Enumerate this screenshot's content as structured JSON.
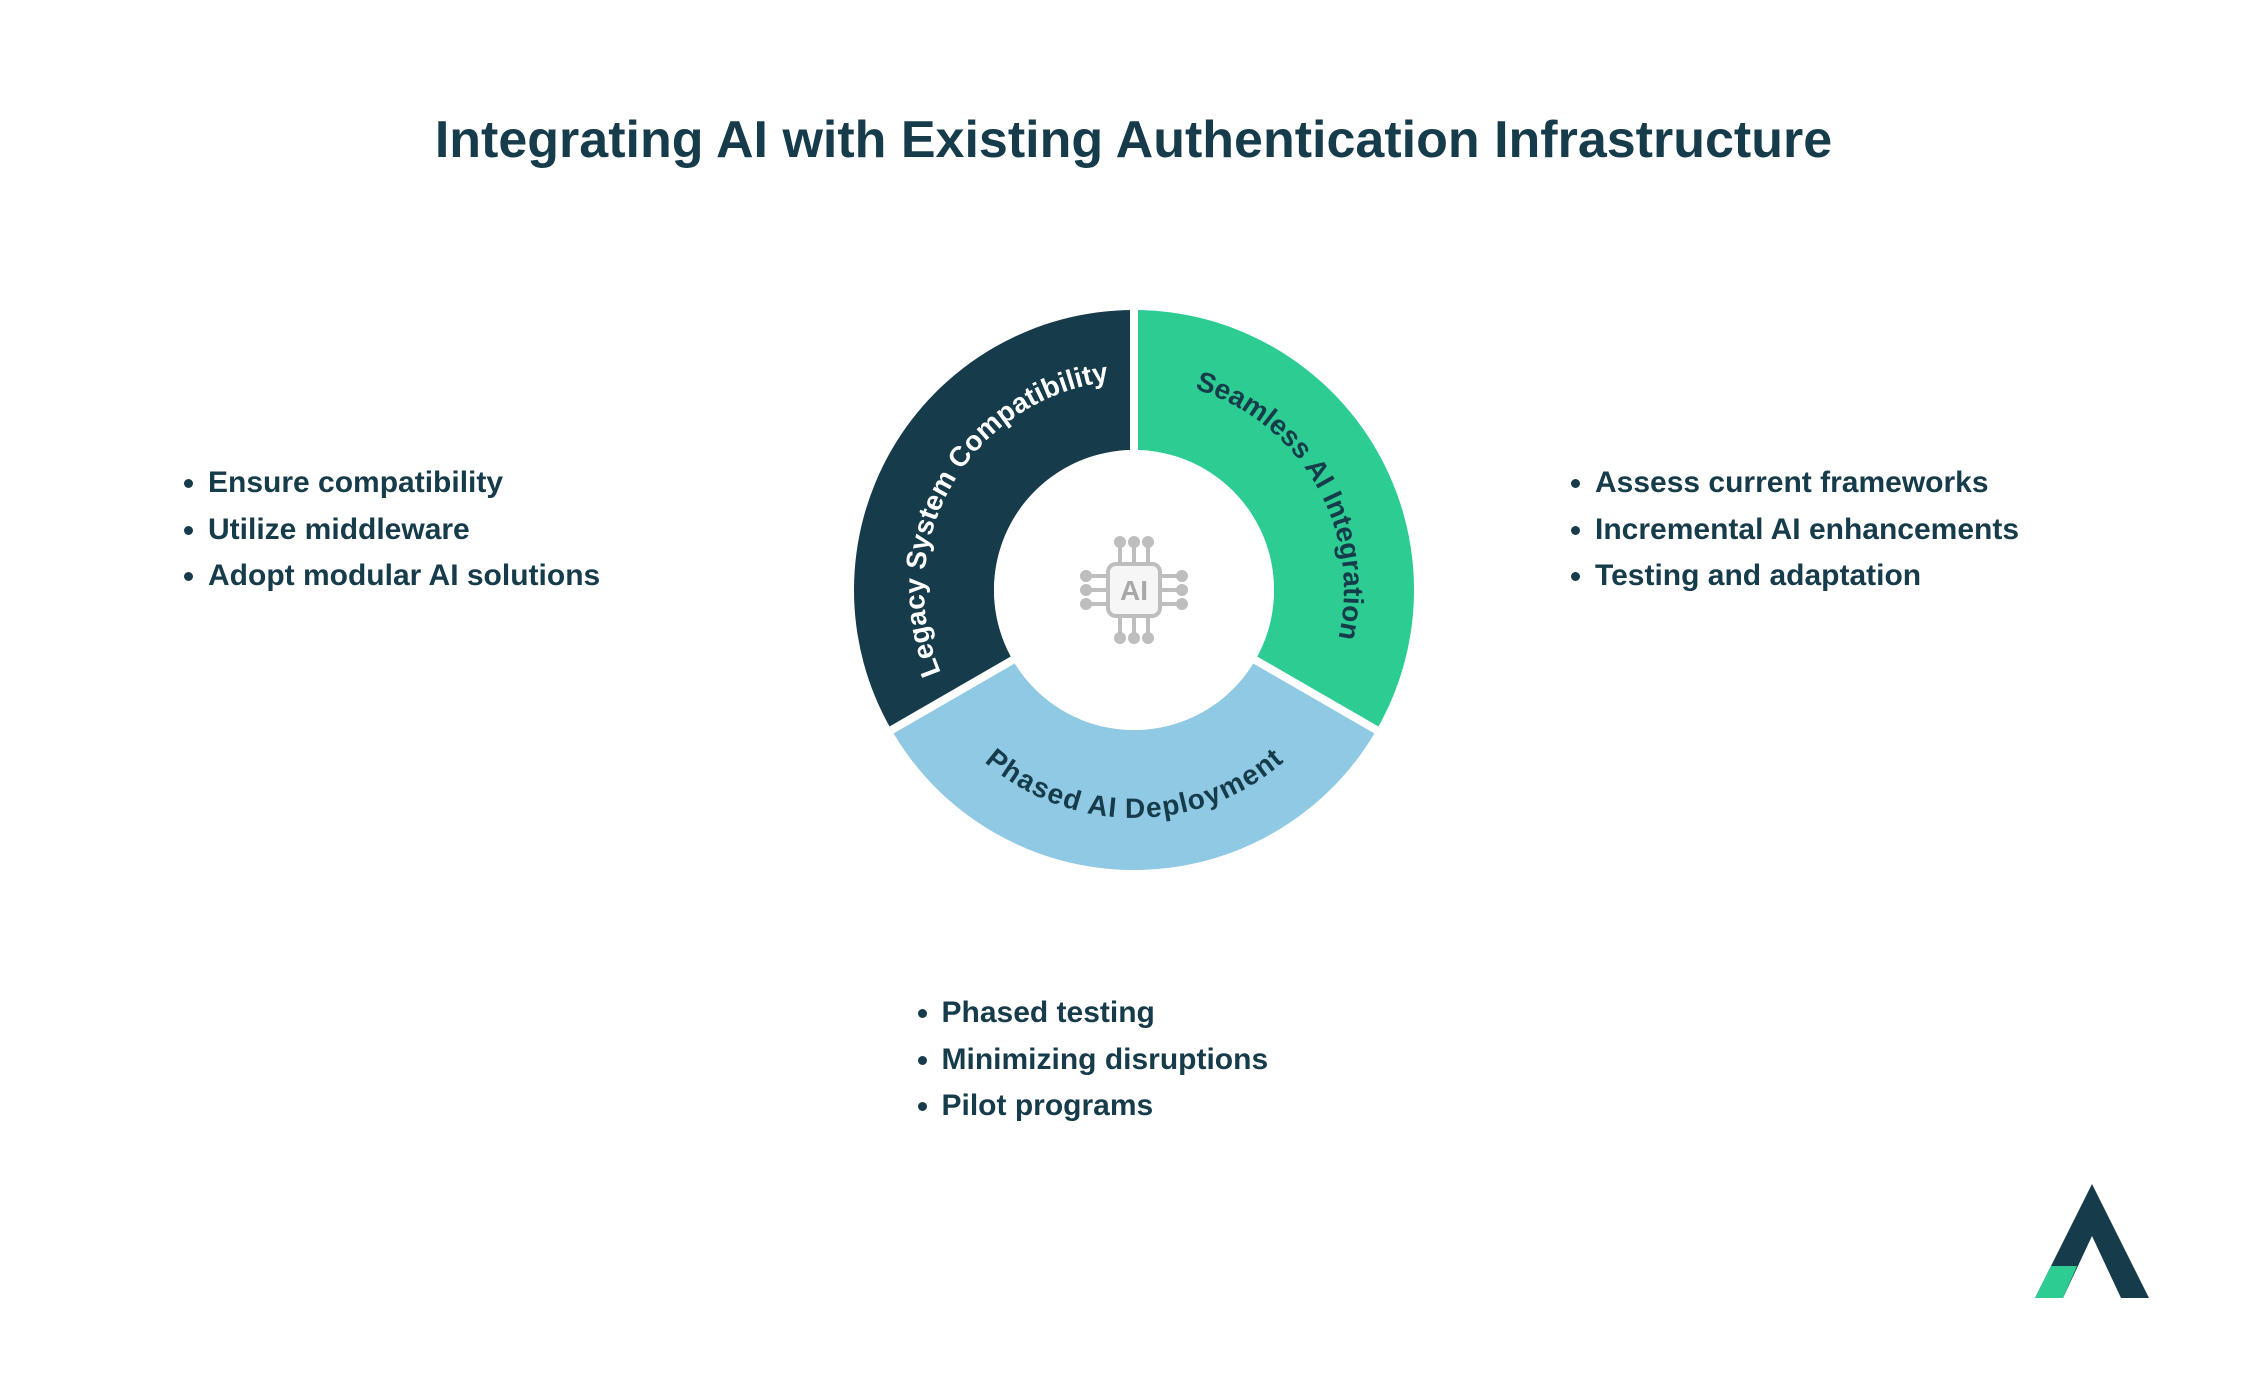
{
  "title": "Integrating AI with Existing Authentication Infrastructure",
  "center_label": "AI",
  "segments": {
    "left": {
      "label": "Legacy System Compatibility",
      "color": "#163B4A"
    },
    "right": {
      "label": "Seamless AI Integration",
      "color": "#2CCC92"
    },
    "bottom": {
      "label": "Phased AI Deployment",
      "color": "#8FC9E3"
    }
  },
  "bullets": {
    "left": [
      "Ensure compatibility",
      "Utilize middleware",
      "Adopt modular AI solutions"
    ],
    "right": [
      "Assess current frameworks",
      "Incremental AI enhancements",
      "Testing and adaptation"
    ],
    "bottom": [
      "Phased testing",
      "Minimizing disruptions",
      "Pilot programs"
    ]
  },
  "colors": {
    "navy": "#163B4A",
    "green": "#2CCC92",
    "sky": "#8FC9E3"
  },
  "chart_data": {
    "type": "pie",
    "title": "Integrating AI with Existing Authentication Infrastructure",
    "categories": [
      "Legacy System Compatibility",
      "Seamless AI Integration",
      "Phased AI Deployment"
    ],
    "values": [
      1,
      1,
      1
    ],
    "series": [
      {
        "name": "Legacy System Compatibility",
        "value": 1,
        "color": "#163B4A",
        "details": [
          "Ensure compatibility",
          "Utilize middleware",
          "Adopt modular AI solutions"
        ]
      },
      {
        "name": "Seamless AI Integration",
        "value": 1,
        "color": "#2CCC92",
        "details": [
          "Assess current frameworks",
          "Incremental AI enhancements",
          "Testing and adaptation"
        ]
      },
      {
        "name": "Phased AI Deployment",
        "value": 1,
        "color": "#8FC9E3",
        "details": [
          "Phased testing",
          "Minimizing disruptions",
          "Pilot programs"
        ]
      }
    ],
    "inner_radius_ratio": 0.5,
    "center_label": "AI"
  }
}
